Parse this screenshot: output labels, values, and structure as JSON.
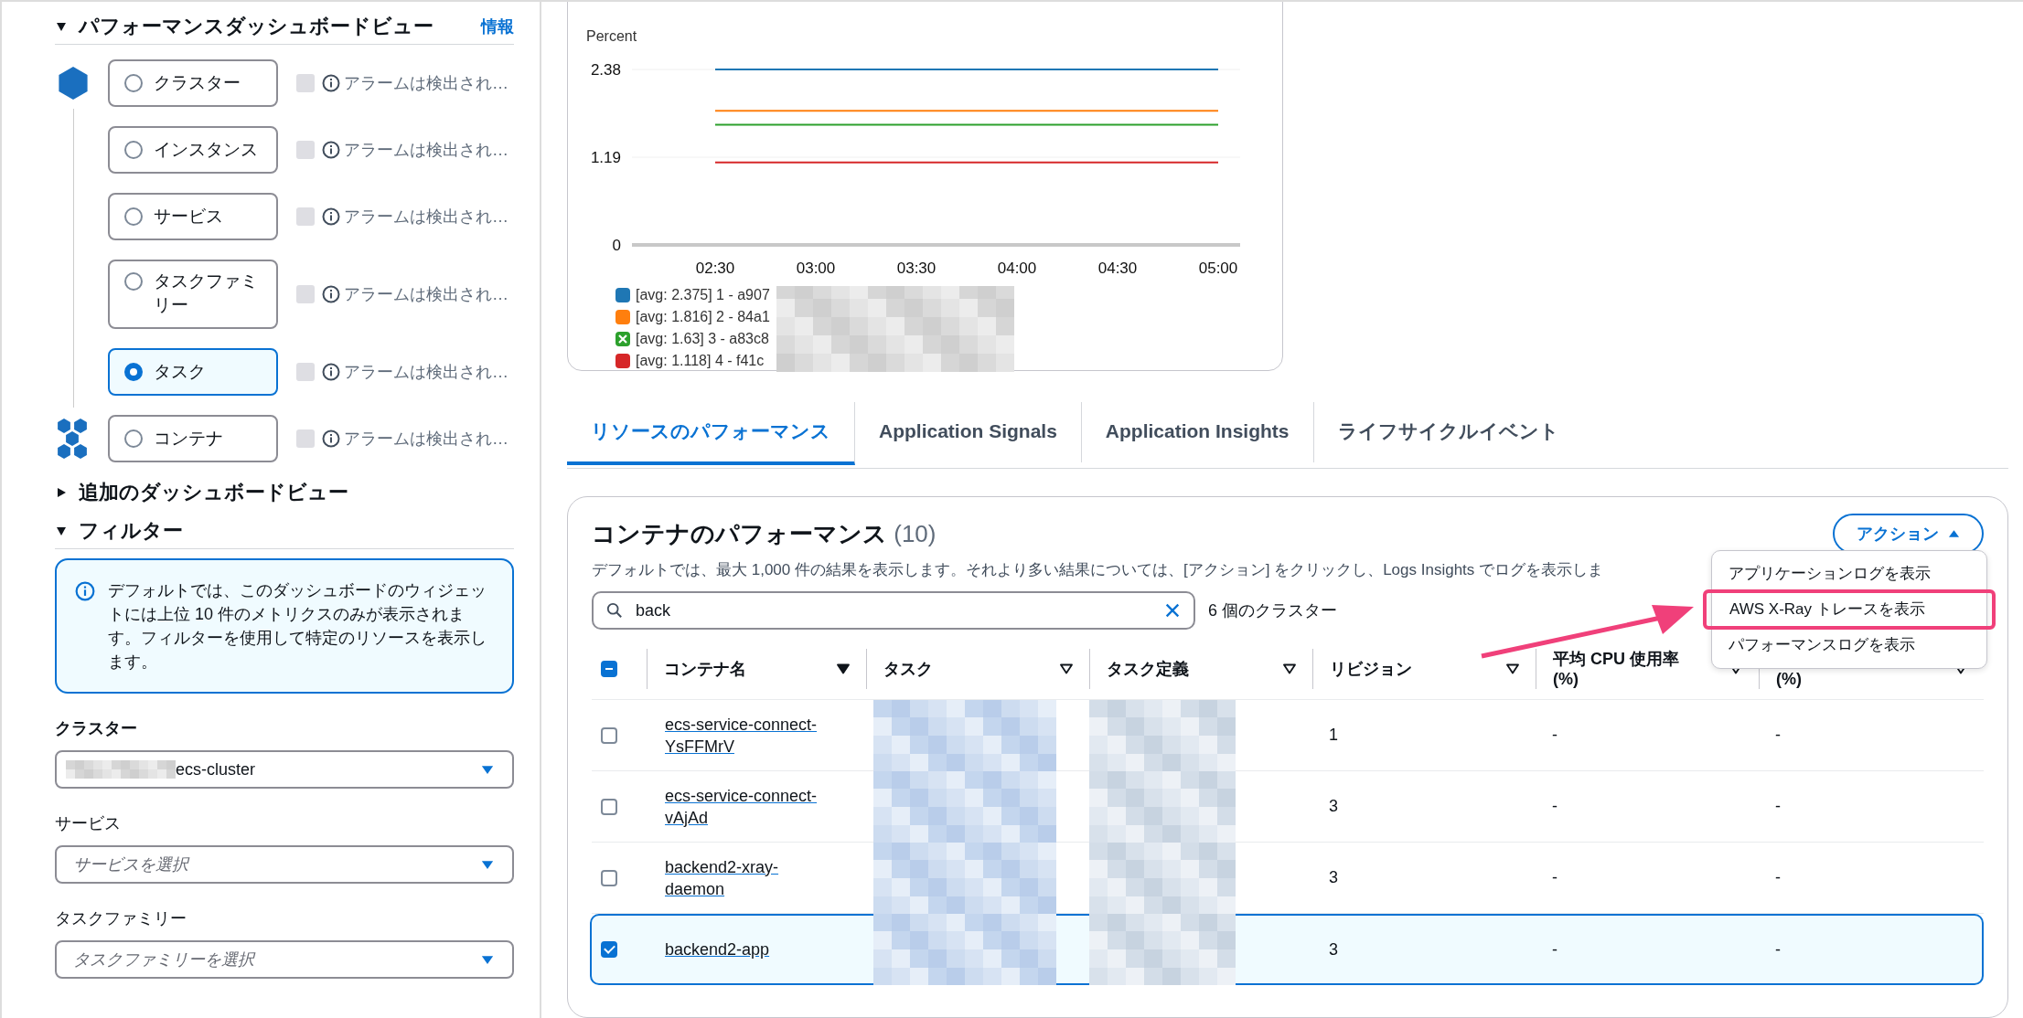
{
  "sidebar": {
    "dashboard_section": {
      "title": "パフォーマンスダッシュボードビュー",
      "expanded": true,
      "info_link": "情報",
      "levels": [
        {
          "label": "クラスター",
          "selected": false,
          "kind": "hexagon",
          "alarm": "アラームは検出され…",
          "alarm_checkbox_disabled": true
        },
        {
          "label": "インスタンス",
          "selected": false,
          "kind": "plain",
          "alarm": "アラームは検出され…",
          "alarm_checkbox_disabled": true
        },
        {
          "label": "サービス",
          "selected": false,
          "kind": "plain",
          "alarm": "アラームは検出され…",
          "alarm_checkbox_disabled": true
        },
        {
          "label": "タスクファミリー",
          "selected": false,
          "kind": "plain",
          "alarm": "アラームは検出され…",
          "alarm_checkbox_disabled": true
        },
        {
          "label": "タスク",
          "selected": true,
          "kind": "plain",
          "alarm": "アラームは検出され…",
          "alarm_checkbox_disabled": true
        },
        {
          "label": "コンテナ",
          "selected": false,
          "kind": "hexagons",
          "alarm": "アラームは検出され…",
          "alarm_checkbox_disabled": true
        }
      ]
    },
    "more_section": {
      "title": "追加のダッシュボードビュー",
      "expanded": false
    },
    "filter_section": {
      "title": "フィルター",
      "expanded": true,
      "info": "デフォルトでは、このダッシュボードのウィジェットには上位 10 件のメトリクスのみが表示されます。フィルターを使用して特定のリソースを表示します。",
      "fields": [
        {
          "label": "クラスター",
          "emphasized": true,
          "value": "ecs-cluster",
          "value_blurred_prefix": true
        },
        {
          "label": "サービス",
          "emphasized": false,
          "placeholder": "サービスを選択"
        },
        {
          "label": "タスクファミリー",
          "emphasized": false,
          "placeholder": "タスクファミリーを選択"
        }
      ]
    }
  },
  "chart": {
    "legend_swatches": [
      {
        "kind": "square"
      },
      {
        "kind": "square"
      },
      {
        "kind": "cross"
      },
      {
        "kind": "square"
      }
    ],
    "chart_data": {
      "type": "line",
      "legend": "bottom",
      "ylabel": "Percent",
      "x": [
        "02:30",
        "03:00",
        "03:30",
        "04:00",
        "04:30",
        "05:00"
      ],
      "ylim": [
        0,
        2.38
      ],
      "yticks": [
        0,
        1.19,
        2.38
      ],
      "series": [
        {
          "name": "[avg: 2.375] 1 - a907",
          "color": "#1f77b4",
          "values": [
            2.38,
            2.38,
            2.38,
            2.38,
            2.38,
            2.38
          ]
        },
        {
          "name": "[avg: 1.816] 2 - 84a1",
          "color": "#ff7f0e",
          "values": [
            1.82,
            1.82,
            1.82,
            1.82,
            1.82,
            1.82
          ]
        },
        {
          "name": "[avg: 1.63] 3 - a83c8",
          "color": "#2ca02c",
          "values": [
            1.63,
            1.63,
            1.63,
            1.63,
            1.63,
            1.63
          ]
        },
        {
          "name": "[avg: 1.118] 4 - f41c",
          "color": "#d62728",
          "values": [
            1.12,
            1.12,
            1.12,
            1.12,
            1.12,
            1.12
          ]
        }
      ]
    }
  },
  "tabs": [
    {
      "label": "リソースのパフォーマンス",
      "selected": true
    },
    {
      "label": "Application Signals",
      "selected": false
    },
    {
      "label": "Application Insights",
      "selected": false
    },
    {
      "label": "ライフサイクルイベント",
      "selected": false
    }
  ],
  "panel": {
    "title": "コンテナのパフォーマンス",
    "count": "(10)",
    "description": "デフォルトでは、最大 1,000 件の結果を表示します。それより多い結果については、[アクション] をクリックし、Logs Insights でログを表示しま",
    "actions_button": {
      "label": "アクション",
      "expanded": true
    },
    "search": {
      "value": "back"
    },
    "result_count": "6 個のクラスター",
    "header_checkbox": {
      "indeterminate": true
    },
    "columns": [
      {
        "label": "コンテナ名",
        "sorted": true
      },
      {
        "label": "タスク",
        "sorted": false
      },
      {
        "label": "タスク定義",
        "sorted": false
      },
      {
        "label": "リビジョン",
        "sorted": false
      },
      {
        "label": "平均 CPU 使用率 (%)",
        "sorted": false
      },
      {
        "label": "(%)",
        "sorted": false
      }
    ],
    "rows": [
      {
        "name": "ecs-service-connect-YsFFMrV",
        "revision": "1",
        "cpu": "-",
        "memory": "-",
        "selected": false
      },
      {
        "name": "ecs-service-connect-vAjAd",
        "revision": "3",
        "cpu": "-",
        "memory": "-",
        "selected": false
      },
      {
        "name": "backend2-xray-daemon",
        "revision": "3",
        "cpu": "-",
        "memory": "-",
        "selected": false
      },
      {
        "name": "backend2-app",
        "revision": "3",
        "cpu": "-",
        "memory": "-",
        "selected": true
      }
    ],
    "menu": {
      "items": [
        {
          "label": "アプリケーションログを表示",
          "highlighted": false
        },
        {
          "label": "AWS X-Ray トレースを表示",
          "highlighted": true
        },
        {
          "label": "パフォーマンスログを表示",
          "highlighted": false
        }
      ]
    }
  }
}
